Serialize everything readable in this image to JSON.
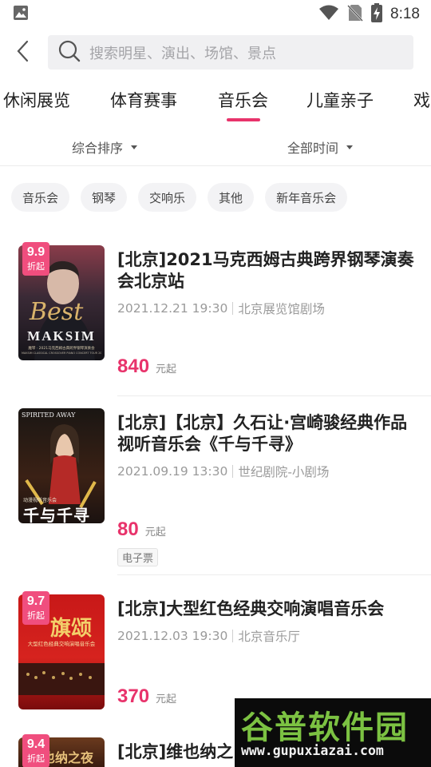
{
  "status_bar": {
    "time": "8:18"
  },
  "search": {
    "placeholder": "搜索明星、演出、场馆、景点"
  },
  "tabs": [
    {
      "label": "休闲展览"
    },
    {
      "label": "体育赛事"
    },
    {
      "label": "音乐会",
      "active": true
    },
    {
      "label": "儿童亲子"
    },
    {
      "label": "戏"
    }
  ],
  "filters": {
    "sort_label": "综合排序",
    "time_label": "全部时间"
  },
  "chips": [
    {
      "label": "音乐会"
    },
    {
      "label": "钢琴"
    },
    {
      "label": "交响乐"
    },
    {
      "label": "其他"
    },
    {
      "label": "新年音乐会"
    }
  ],
  "events": [
    {
      "rating": "9.9",
      "rating_note": "折起",
      "title": "[北京]2021马克西姆古典跨界钢琴演奏会北京站",
      "datetime": "2021.12.21 19:30",
      "venue": "北京展览馆剧场",
      "price": "840",
      "price_unit": "元起",
      "poster_text": {
        "line1": "Best",
        "line2": "MAKSIM",
        "line3": "魔琴 · 2021马克西姆古典跨界钢琴演奏会",
        "line4": "MAKSIM CLASSICAL CROSSOVER PIANO CONCERT TOUR 2021"
      }
    },
    {
      "title": "[北京]【北京】久石让·宫崎骏经典作品视听音乐会《千与千寻》",
      "datetime": "2021.09.19 13:30",
      "venue": "世纪剧院-小剧场",
      "price": "80",
      "price_unit": "元起",
      "ticket_tag": "电子票",
      "poster_text": {
        "line1": "SPIRITED AWAY",
        "line2": "动漫视听音乐会",
        "line3": "千与千寻"
      }
    },
    {
      "rating": "9.7",
      "rating_note": "折起",
      "title": "[北京]大型红色经典交响演唱音乐会",
      "datetime": "2021.12.03 19:30",
      "venue": "北京音乐厅",
      "price": "370",
      "price_unit": "元起",
      "poster_text": {
        "line1": "旗颂",
        "line2": "大型红色经典交响演唱音乐会"
      }
    },
    {
      "rating": "9.4",
      "rating_note": "折起",
      "title": "[北京]维也纳之",
      "poster_text": {
        "line1": "也纳之夜"
      }
    }
  ],
  "watermark": {
    "title": "谷普软件园",
    "url": "www.gupuxiazai.com"
  },
  "colors": {
    "accent": "#e8336b",
    "rating_badge": "#f04e7e",
    "search_bg": "#f0f0f2",
    "watermark_green": "#7cc242"
  }
}
